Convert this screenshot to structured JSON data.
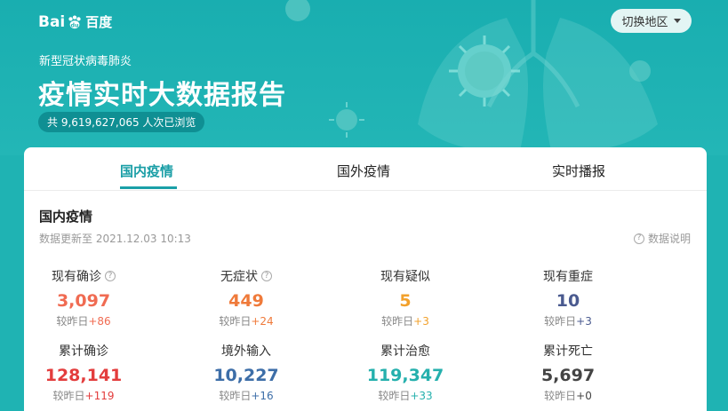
{
  "header": {
    "logo_en": "Bai",
    "logo_paw": "du",
    "logo_cn": "百度",
    "switch_region": "切换地区",
    "subtitle": "新型冠状病毒肺炎",
    "title": "疫情实时大数据报告",
    "views": "共 9,619,627,065 人次已浏览"
  },
  "tabs": [
    {
      "label": "国内疫情",
      "active": true
    },
    {
      "label": "国外疫情",
      "active": false
    },
    {
      "label": "实时播报",
      "active": false
    }
  ],
  "section": {
    "title": "国内疫情",
    "update_time": "数据更新至 2021.12.03 10:13",
    "explain": "数据说明"
  },
  "delta_prefix": "较昨日",
  "stats": [
    {
      "label": "现有确诊",
      "value": "3,097",
      "delta": "+86",
      "color": "#f06b52",
      "delta_color": "#f06b52",
      "help": true
    },
    {
      "label": "无症状",
      "value": "449",
      "delta": "+24",
      "color": "#ef7a3a",
      "delta_color": "#ef7a3a",
      "help": true
    },
    {
      "label": "现有疑似",
      "value": "5",
      "delta": "+3",
      "color": "#f2a12c",
      "delta_color": "#f2a12c",
      "help": false
    },
    {
      "label": "现有重症",
      "value": "10",
      "delta": "+3",
      "color": "#4a5a8f",
      "delta_color": "#4a5a8f",
      "help": false
    },
    {
      "label": "累计确诊",
      "value": "128,141",
      "delta": "+119",
      "color": "#e33d3d",
      "delta_color": "#e33d3d",
      "help": false
    },
    {
      "label": "境外输入",
      "value": "10,227",
      "delta": "+16",
      "color": "#3d6ea8",
      "delta_color": "#3d6ea8",
      "help": false
    },
    {
      "label": "累计治愈",
      "value": "119,347",
      "delta": "+33",
      "color": "#25b0ad",
      "delta_color": "#25b0ad",
      "help": false
    },
    {
      "label": "累计死亡",
      "value": "5,697",
      "delta": "+0",
      "color": "#444444",
      "delta_color": "#444444",
      "help": false
    }
  ],
  "icons": {
    "help": "question-circle-icon",
    "caret": "caret-down-icon",
    "logo": "baidu-paw-icon"
  }
}
